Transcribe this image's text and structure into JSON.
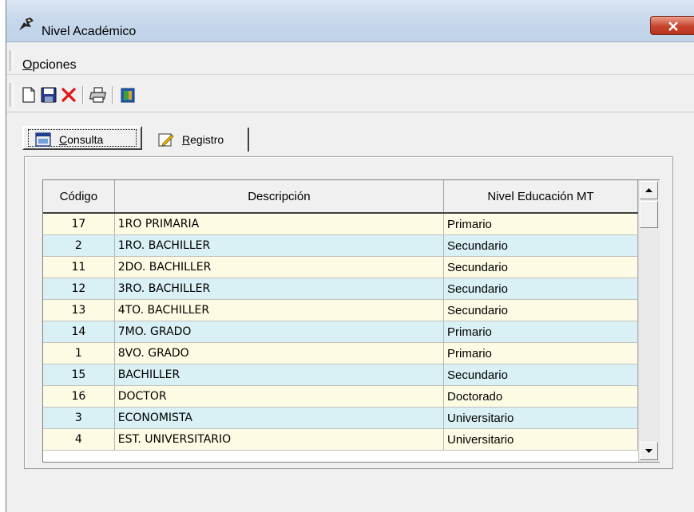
{
  "window": {
    "title": "Nivel Académico"
  },
  "menu": {
    "opciones_u": "O",
    "opciones_rest": "pciones"
  },
  "toolbar": {
    "icons": [
      "new-icon",
      "save-icon",
      "delete-icon",
      "print-icon",
      "exit-icon"
    ]
  },
  "tabs": {
    "consulta_u": "C",
    "consulta_rest": "onsulta",
    "registro_u": "R",
    "registro_rest": "egistro"
  },
  "grid": {
    "headers": [
      "Código",
      "Descripción",
      "Nivel Educación MT"
    ],
    "rows": [
      [
        "17",
        "1RO PRIMARIA",
        "Primario"
      ],
      [
        "2",
        "1RO. BACHILLER",
        "Secundario"
      ],
      [
        "11",
        "2DO. BACHILLER",
        "Secundario"
      ],
      [
        "12",
        "3RO. BACHILLER",
        "Secundario"
      ],
      [
        "13",
        "4TO. BACHILLER",
        "Secundario"
      ],
      [
        "14",
        "7MO. GRADO",
        "Primario"
      ],
      [
        "1",
        "8VO. GRADO",
        "Primario"
      ],
      [
        "15",
        "BACHILLER",
        "Secundario"
      ],
      [
        "16",
        "DOCTOR",
        "Doctorado"
      ],
      [
        "3",
        "ECONOMISTA",
        "Universitario"
      ],
      [
        "4",
        "EST. UNIVERSITARIO",
        "Universitario"
      ]
    ]
  },
  "colors": {
    "row_a": "#fdfbe3",
    "row_b": "#d9f0f4",
    "close": "#c7432d"
  }
}
